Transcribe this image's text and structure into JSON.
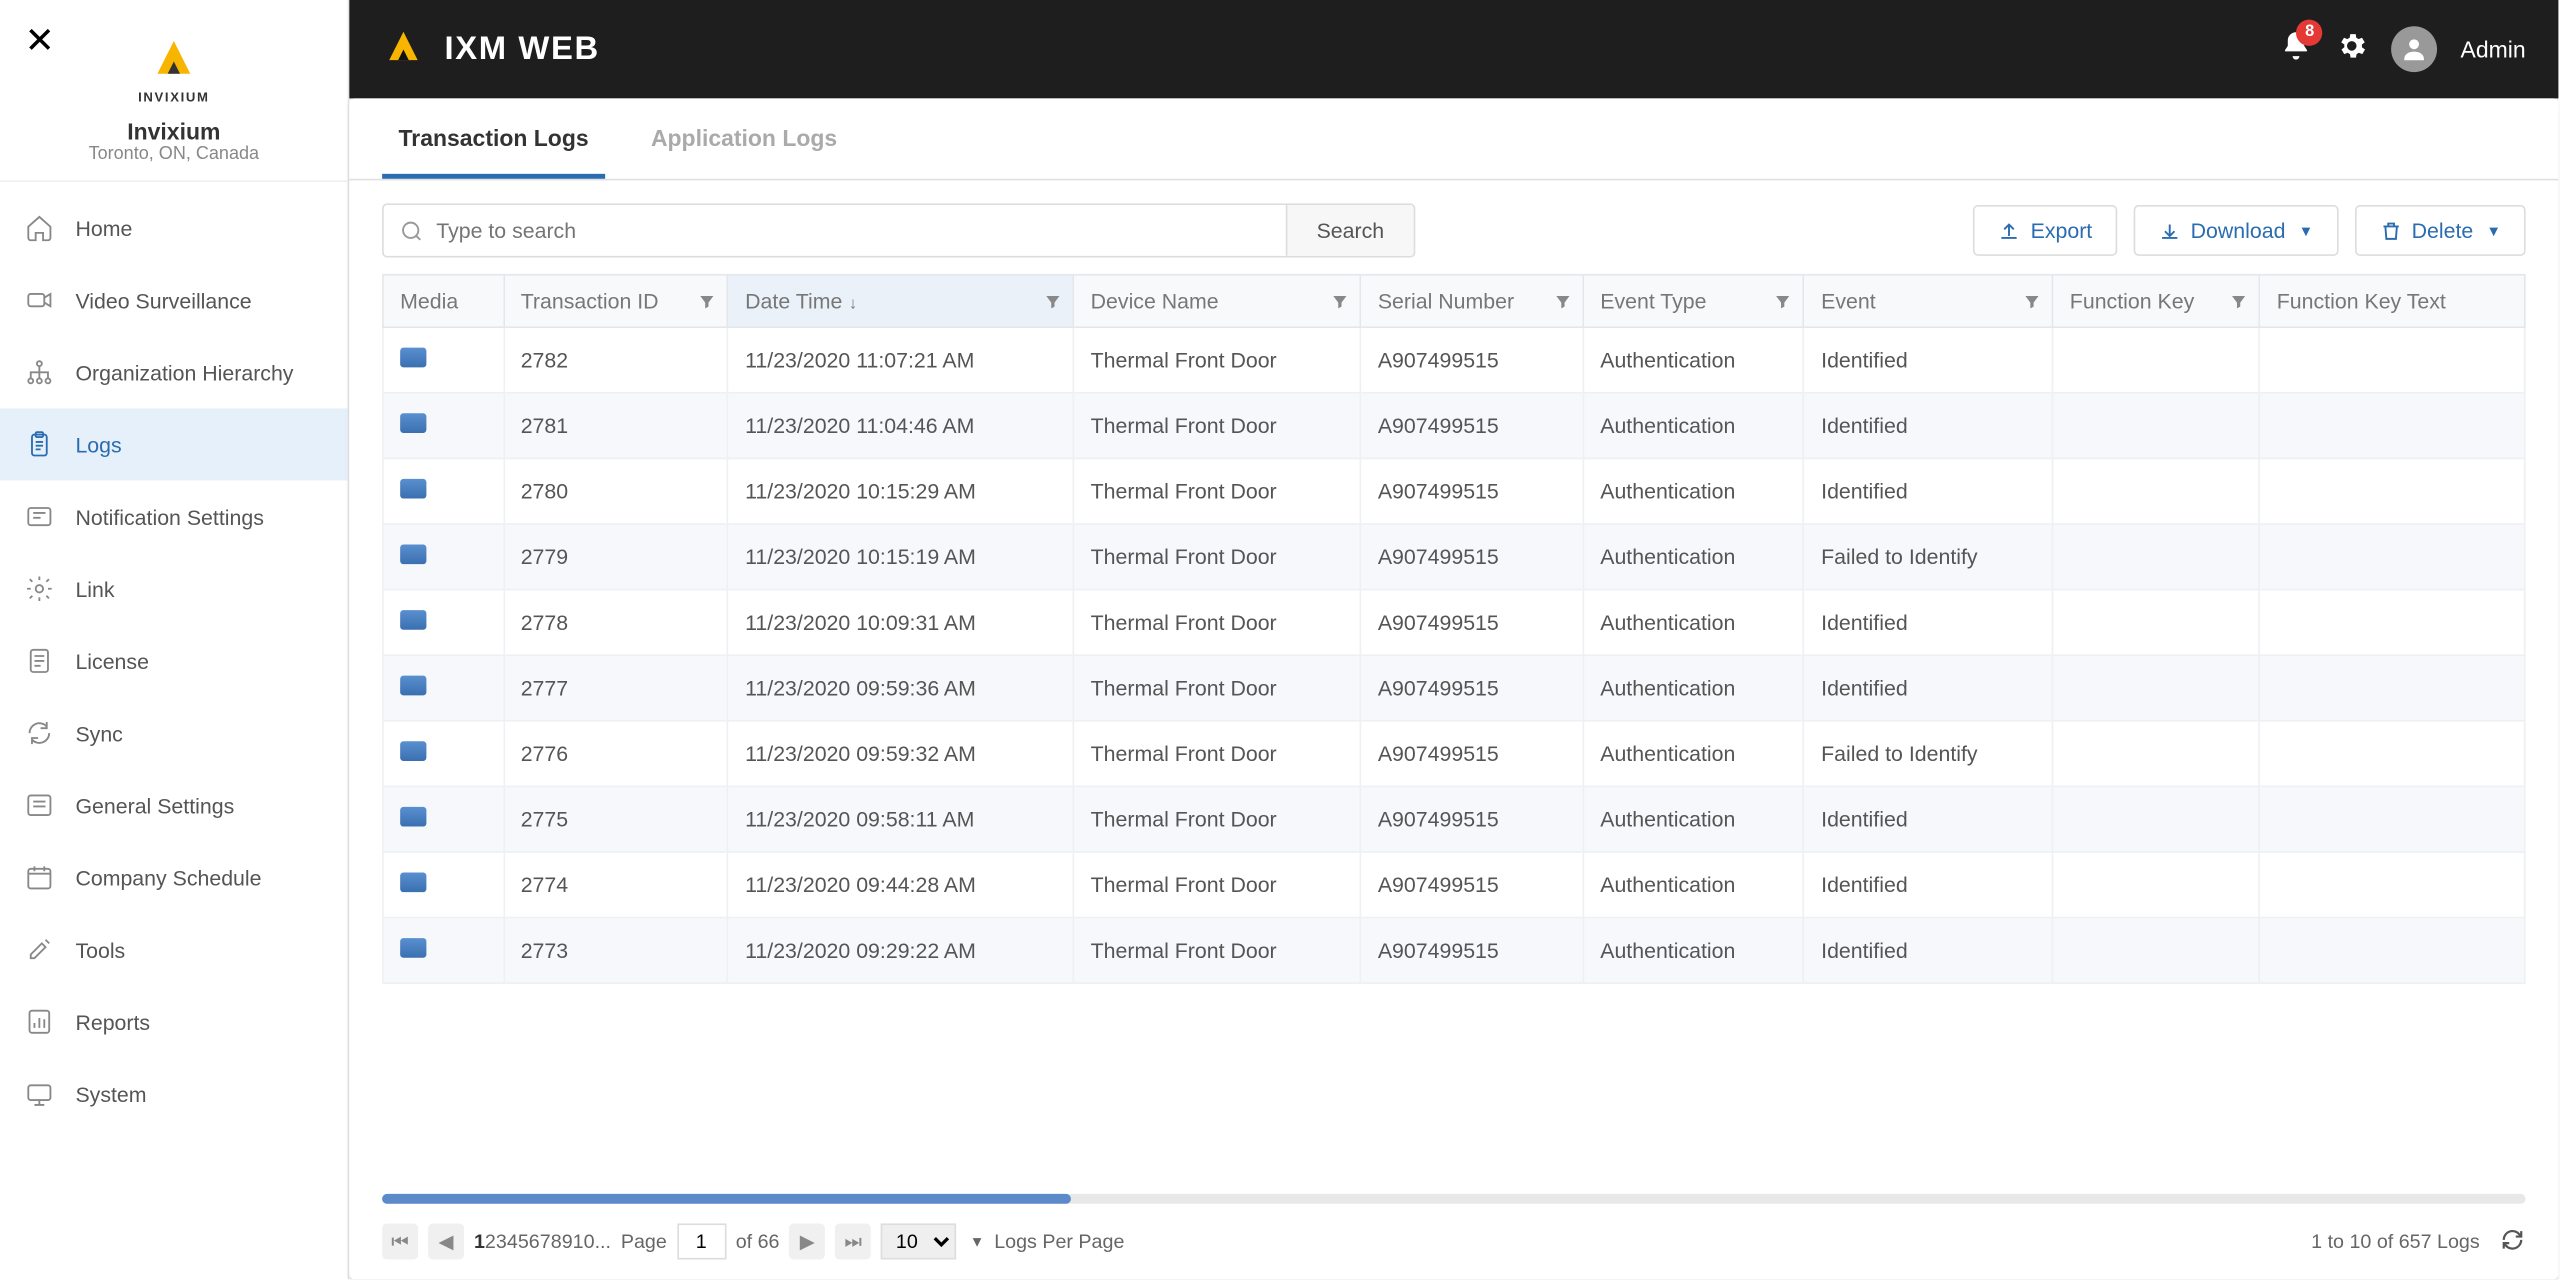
{
  "brand": {
    "name": "INVIXIUM"
  },
  "org": {
    "name": "Invixium",
    "location": "Toronto, ON, Canada"
  },
  "sidebar": {
    "items": [
      {
        "label": "Home",
        "icon": "home-icon"
      },
      {
        "label": "Video Surveillance",
        "icon": "camera-icon"
      },
      {
        "label": "Organization Hierarchy",
        "icon": "hierarchy-icon"
      },
      {
        "label": "Logs",
        "icon": "clipboard-icon"
      },
      {
        "label": "Notification Settings",
        "icon": "notification-settings-icon"
      },
      {
        "label": "Link",
        "icon": "link-gear-icon"
      },
      {
        "label": "License",
        "icon": "license-icon"
      },
      {
        "label": "Sync",
        "icon": "sync-icon"
      },
      {
        "label": "General Settings",
        "icon": "settings-panel-icon"
      },
      {
        "label": "Company Schedule",
        "icon": "schedule-icon"
      },
      {
        "label": "Tools",
        "icon": "tools-icon"
      },
      {
        "label": "Reports",
        "icon": "reports-icon"
      },
      {
        "label": "System",
        "icon": "system-icon"
      }
    ],
    "active_index": 3
  },
  "header": {
    "app_title": "IXM WEB",
    "notification_count": "8",
    "username": "Admin"
  },
  "tabs": [
    {
      "label": "Transaction Logs",
      "active": true
    },
    {
      "label": "Application Logs",
      "active": false
    }
  ],
  "toolbar": {
    "search_placeholder": "Type to search",
    "search_button": "Search",
    "export": "Export",
    "download": "Download",
    "delete": "Delete"
  },
  "table": {
    "columns": [
      "Media",
      "Transaction ID",
      "Date Time",
      "Device Name",
      "Serial Number",
      "Event Type",
      "Event",
      "Function Key",
      "Function Key Text"
    ],
    "rows": [
      {
        "tid": "2782",
        "dt": "11/23/2020 11:07:21 AM",
        "dev": "Thermal Front Door",
        "sn": "A907499515",
        "etype": "Authentication",
        "event": "Identified",
        "fk": "",
        "fkt": ""
      },
      {
        "tid": "2781",
        "dt": "11/23/2020 11:04:46 AM",
        "dev": "Thermal Front Door",
        "sn": "A907499515",
        "etype": "Authentication",
        "event": "Identified",
        "fk": "",
        "fkt": ""
      },
      {
        "tid": "2780",
        "dt": "11/23/2020 10:15:29 AM",
        "dev": "Thermal Front Door",
        "sn": "A907499515",
        "etype": "Authentication",
        "event": "Identified",
        "fk": "",
        "fkt": ""
      },
      {
        "tid": "2779",
        "dt": "11/23/2020 10:15:19 AM",
        "dev": "Thermal Front Door",
        "sn": "A907499515",
        "etype": "Authentication",
        "event": "Failed to Identify",
        "fk": "",
        "fkt": ""
      },
      {
        "tid": "2778",
        "dt": "11/23/2020 10:09:31 AM",
        "dev": "Thermal Front Door",
        "sn": "A907499515",
        "etype": "Authentication",
        "event": "Identified",
        "fk": "",
        "fkt": ""
      },
      {
        "tid": "2777",
        "dt": "11/23/2020 09:59:36 AM",
        "dev": "Thermal Front Door",
        "sn": "A907499515",
        "etype": "Authentication",
        "event": "Identified",
        "fk": "",
        "fkt": ""
      },
      {
        "tid": "2776",
        "dt": "11/23/2020 09:59:32 AM",
        "dev": "Thermal Front Door",
        "sn": "A907499515",
        "etype": "Authentication",
        "event": "Failed to Identify",
        "fk": "",
        "fkt": ""
      },
      {
        "tid": "2775",
        "dt": "11/23/2020 09:58:11 AM",
        "dev": "Thermal Front Door",
        "sn": "A907499515",
        "etype": "Authentication",
        "event": "Identified",
        "fk": "",
        "fkt": ""
      },
      {
        "tid": "2774",
        "dt": "11/23/2020 09:44:28 AM",
        "dev": "Thermal Front Door",
        "sn": "A907499515",
        "etype": "Authentication",
        "event": "Identified",
        "fk": "",
        "fkt": ""
      },
      {
        "tid": "2773",
        "dt": "11/23/2020 09:29:22 AM",
        "dev": "Thermal Front Door",
        "sn": "A907499515",
        "etype": "Authentication",
        "event": "Identified",
        "fk": "",
        "fkt": ""
      }
    ]
  },
  "pagination": {
    "pages": [
      "1",
      "2",
      "3",
      "4",
      "5",
      "6",
      "7",
      "8",
      "9",
      "10",
      "..."
    ],
    "page_label": "Page",
    "current_page": "1",
    "of_label": "of 66",
    "page_size": "10",
    "per_page_label": "Logs Per Page",
    "summary": "1 to 10 of 657 Logs"
  }
}
